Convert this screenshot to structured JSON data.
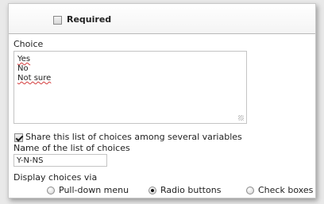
{
  "required": {
    "label": "Required",
    "checked": false
  },
  "choice": {
    "label": "Choice",
    "lines": [
      "Yes",
      "No",
      "Not sure"
    ]
  },
  "share": {
    "label": "Share this list of choices among several variables",
    "checked": true
  },
  "list_name": {
    "label": "Name of the list of choices",
    "value": "Y-N-NS"
  },
  "display": {
    "label": "Display choices via",
    "options": [
      "Pull-down menu",
      "Radio buttons",
      "Check boxes"
    ],
    "selected": "Radio buttons"
  }
}
